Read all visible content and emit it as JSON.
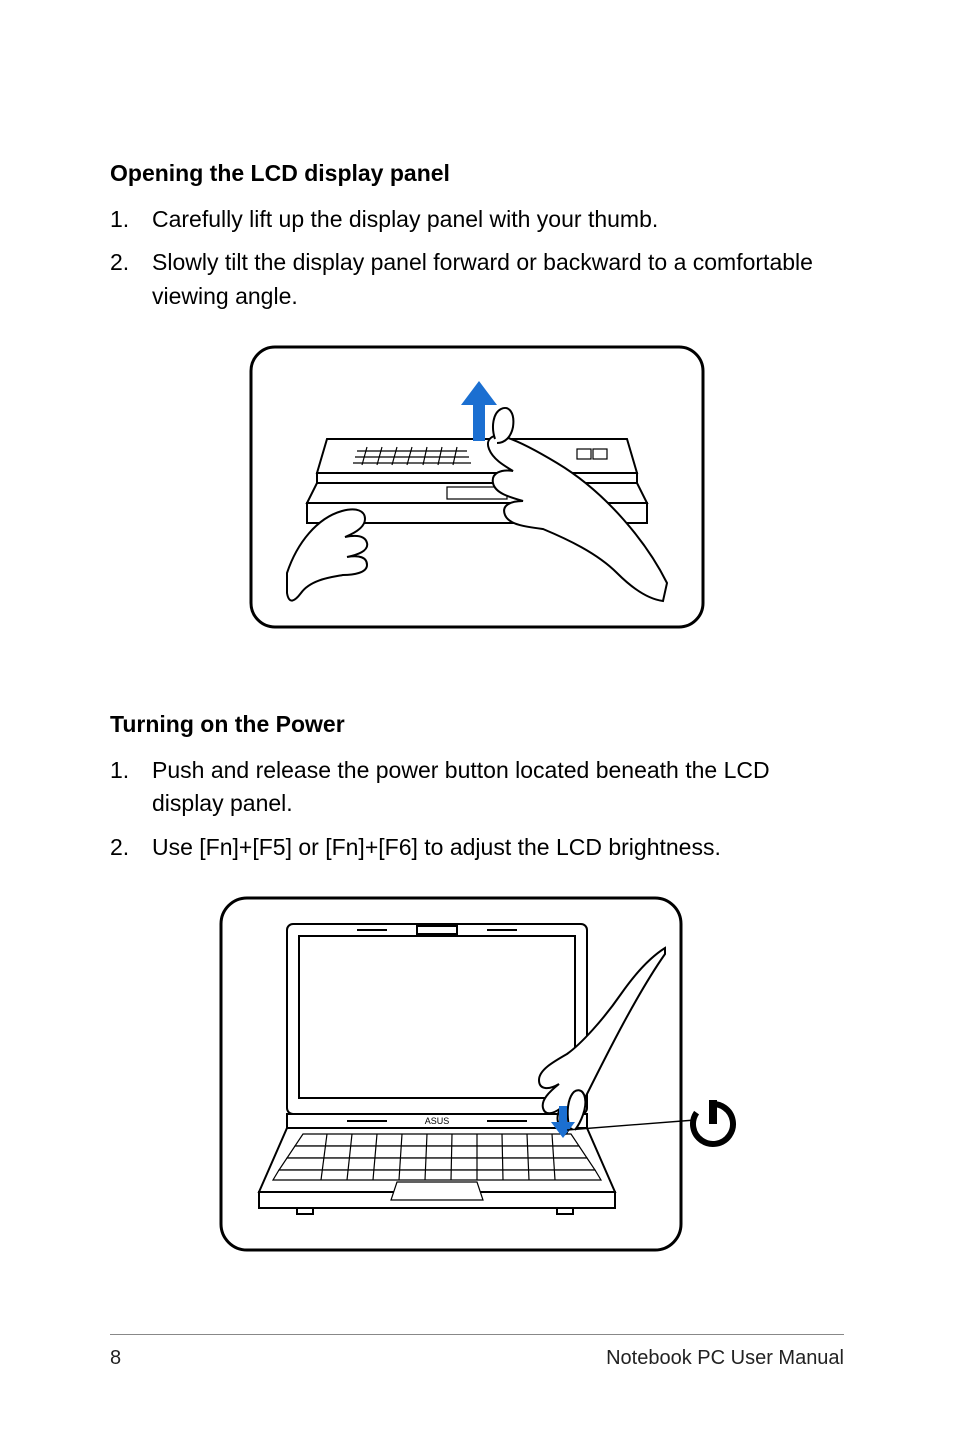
{
  "section1": {
    "heading": "Opening the LCD display panel",
    "steps": [
      {
        "num": "1.",
        "text": "Carefully lift up the display panel with your thumb."
      },
      {
        "num": "2.",
        "text": "Slowly tilt the display panel forward or backward to a comfortable viewing angle."
      }
    ]
  },
  "section2": {
    "heading": "Turning on the Power",
    "steps": [
      {
        "num": "1.",
        "text": "Push and release the power button located beneath the LCD display panel."
      },
      {
        "num": "2.",
        "text": "Use [Fn]+[F5] or [Fn]+[F6] to adjust the LCD brightness."
      }
    ]
  },
  "footer": {
    "page": "8",
    "title": "Notebook PC User Manual"
  }
}
